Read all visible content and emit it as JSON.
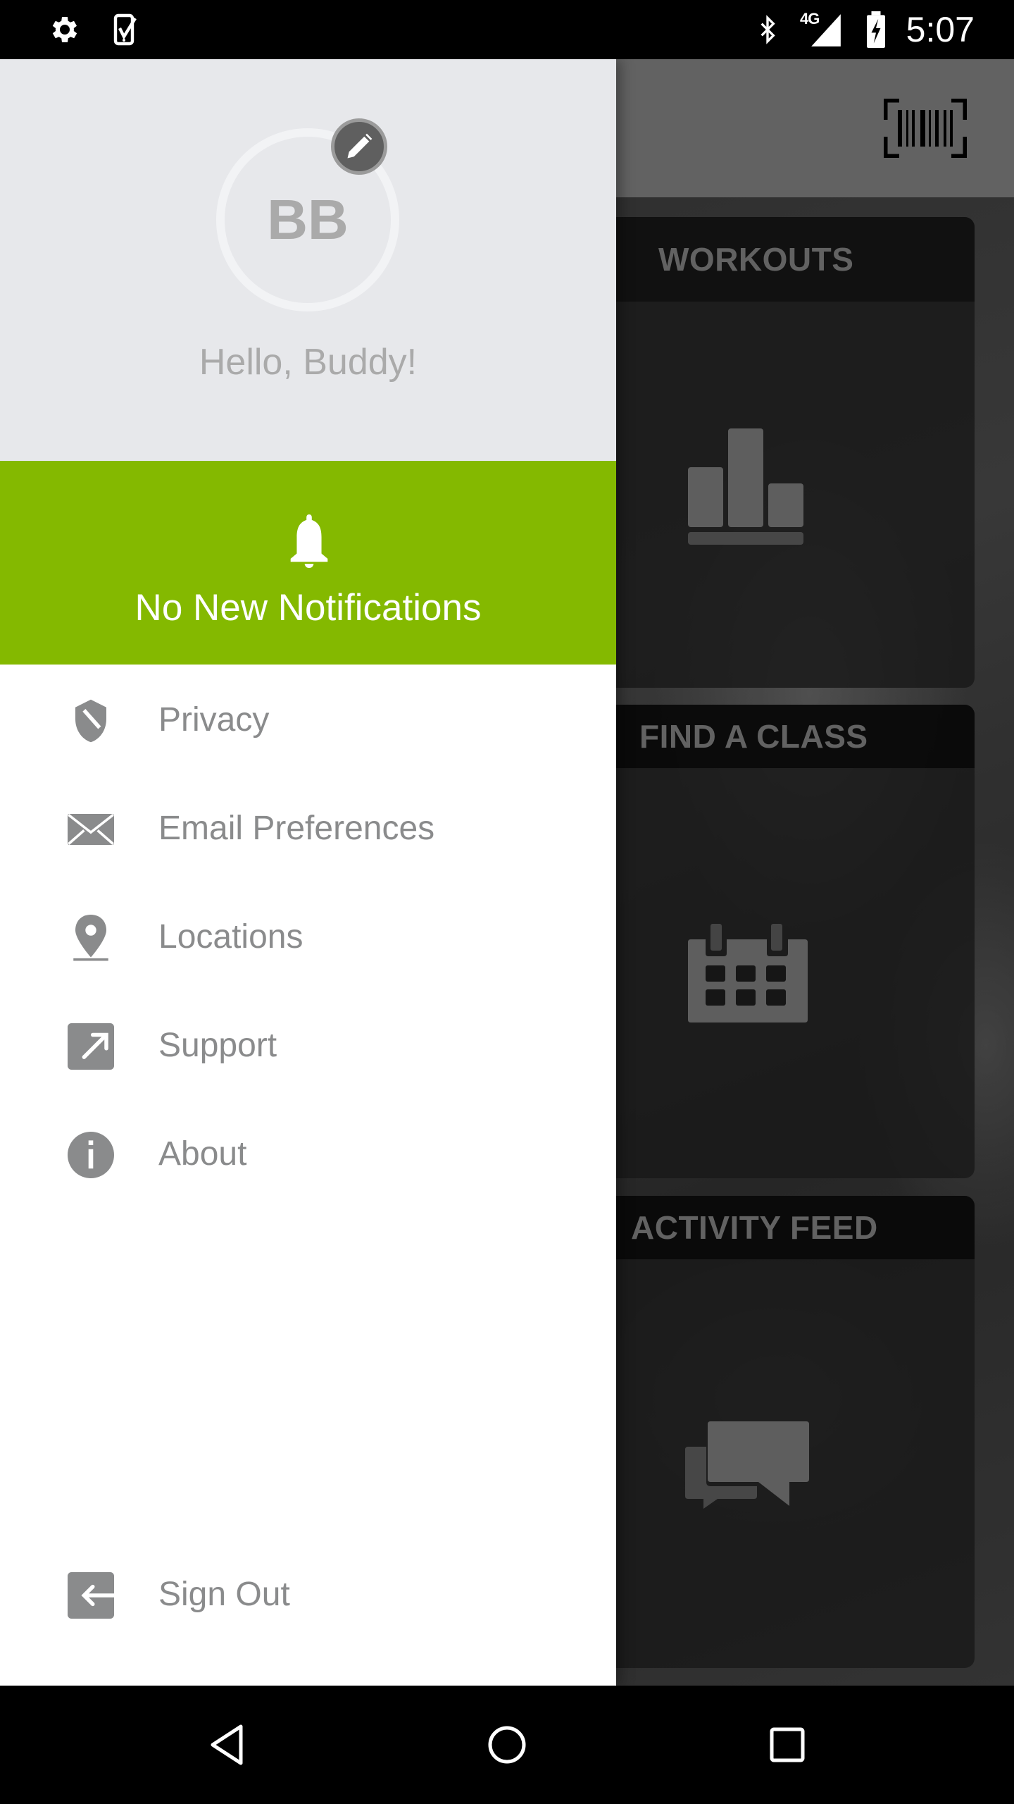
{
  "status_bar": {
    "left_icons": [
      "settings-icon",
      "task-check-icon"
    ],
    "right_icons": [
      "bluetooth-icon",
      "network-4g-icon",
      "signal-icon",
      "battery-charging-icon"
    ],
    "network_label": "4G",
    "time": "5:07"
  },
  "app": {
    "toolbar": {
      "action_icon": "barcode-scan-icon"
    },
    "cards": [
      {
        "title": "WORKOUTS",
        "icon": "bar-chart-icon"
      },
      {
        "title": "FIND A CLASS",
        "icon": "calendar-icon"
      },
      {
        "title": "ACTIVITY FEED",
        "icon": "chat-bubbles-icon"
      }
    ]
  },
  "drawer": {
    "profile": {
      "initials": "BB",
      "greeting": "Hello, Buddy!",
      "edit_icon": "pencil-icon"
    },
    "notifications": {
      "icon": "bell-icon",
      "text": "No New Notifications",
      "background_color": "#84b900"
    },
    "menu": [
      {
        "label": "Privacy",
        "icon": "shield-icon"
      },
      {
        "label": "Email Preferences",
        "icon": "envelope-icon"
      },
      {
        "label": "Locations",
        "icon": "map-pin-icon"
      },
      {
        "label": "Support",
        "icon": "external-link-icon"
      },
      {
        "label": "About",
        "icon": "info-icon"
      }
    ],
    "sign_out": {
      "label": "Sign Out",
      "icon": "sign-out-icon"
    }
  },
  "nav_bar": {
    "buttons": [
      "back",
      "home",
      "recents"
    ]
  }
}
